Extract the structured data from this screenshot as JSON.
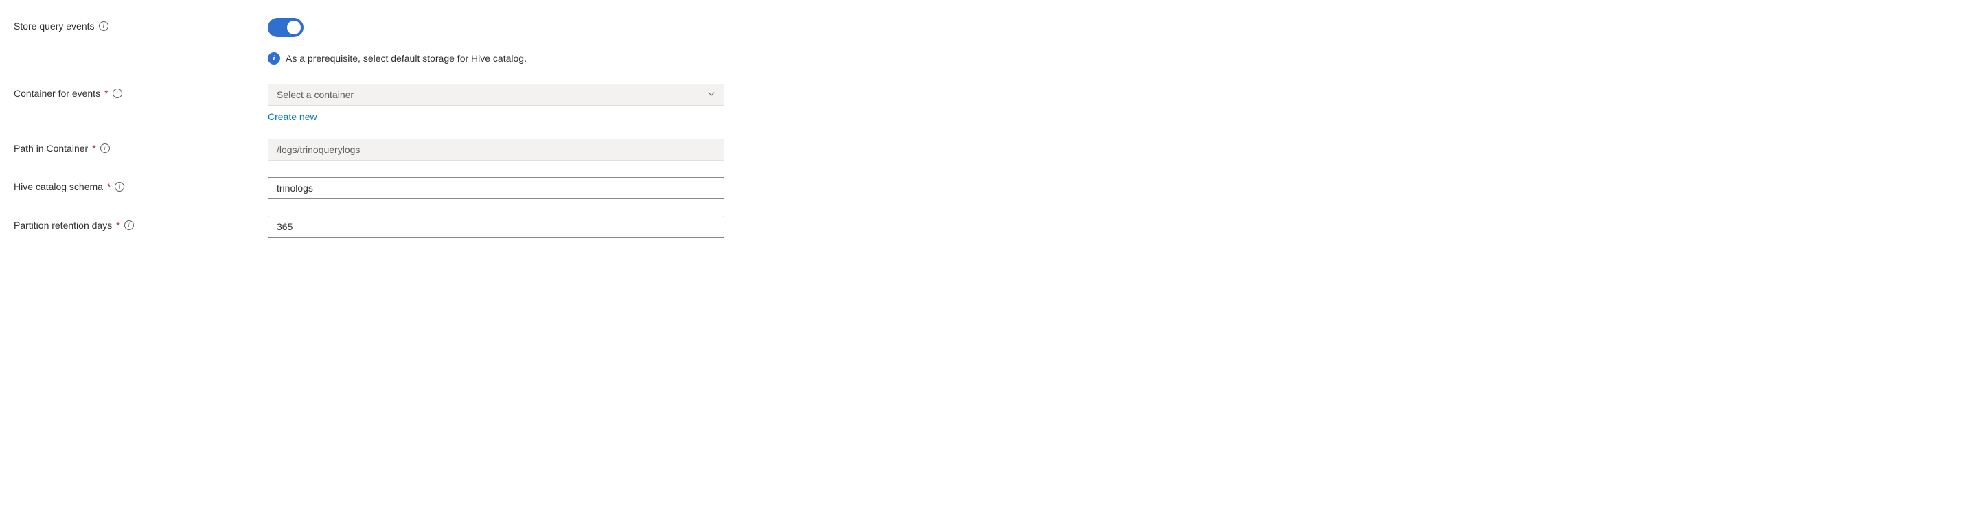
{
  "storeQueryEvents": {
    "label": "Store query events",
    "enabled": true,
    "infoMessage": "As a prerequisite, select default storage for Hive catalog."
  },
  "containerForEvents": {
    "label": "Container for events",
    "placeholder": "Select a container",
    "createNew": "Create new"
  },
  "pathInContainer": {
    "label": "Path in Container",
    "value": "/logs/trinoquerylogs"
  },
  "hiveCatalogSchema": {
    "label": "Hive catalog schema",
    "value": "trinologs"
  },
  "partitionRetentionDays": {
    "label": "Partition retention days",
    "value": "365"
  },
  "requiredMark": "*",
  "infoGlyph": "i"
}
